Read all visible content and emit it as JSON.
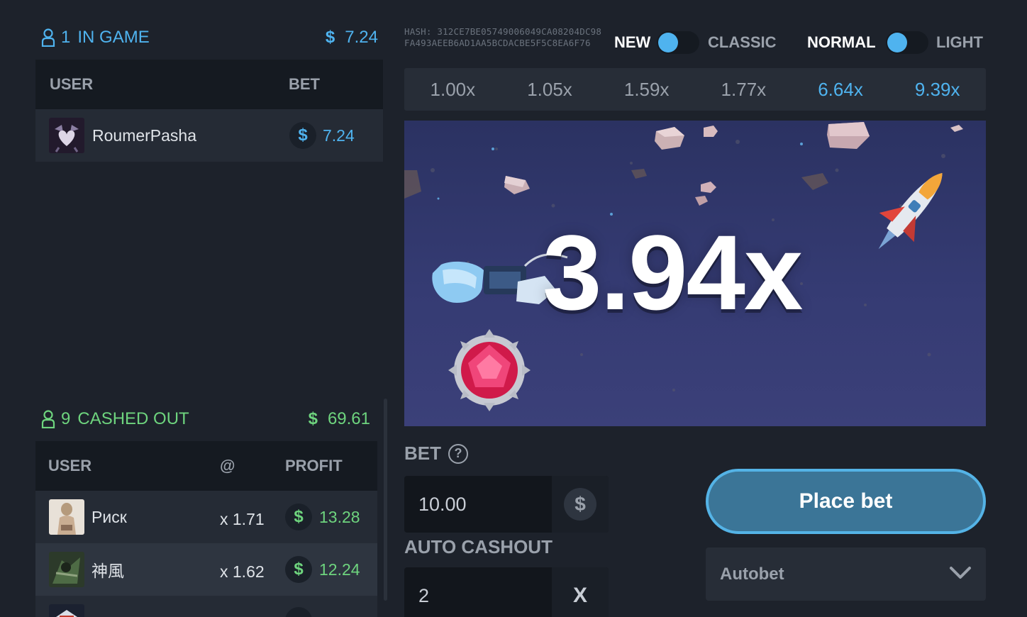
{
  "in_game": {
    "count": "1",
    "label": "IN GAME",
    "currency": "$",
    "amount": "7.24"
  },
  "bets_table": {
    "columns": [
      "USER",
      "BET"
    ],
    "rows": [
      {
        "user": "RoumerPasha",
        "currency": "$",
        "bet": "7.24"
      }
    ]
  },
  "cashed_out": {
    "count": "9",
    "label": "CASHED OUT",
    "currency": "$",
    "amount": "69.61"
  },
  "cashout_table": {
    "columns": [
      "USER",
      "@",
      "PROFIT"
    ],
    "rows": [
      {
        "user": "Риск",
        "at": "x 1.71",
        "currency": "$",
        "profit": "13.28"
      },
      {
        "user": "神風",
        "at": "x 1.62",
        "currency": "$",
        "profit": "12.24"
      }
    ]
  },
  "hash": {
    "text": "HASH: 312CE7BE05749006049CA08204DC98FA493AEEB6AD1AA5BCDACBE5F5C8EA6F76"
  },
  "toggles": {
    "new": "NEW",
    "classic": "CLASSIC",
    "normal": "NORMAL",
    "light": "LIGHT"
  },
  "history": [
    "1.00x",
    "1.05x",
    "1.59x",
    "1.77x",
    "6.64x",
    "9.39x"
  ],
  "game": {
    "multiplier": "3.94x"
  },
  "bet": {
    "label": "BET",
    "help": "?",
    "value": "10.00",
    "currency": "$"
  },
  "auto_cashout": {
    "label": "AUTO CASHOUT",
    "value": "2",
    "suffix": "X"
  },
  "place_bet": {
    "label": "Place bet"
  },
  "autobet": {
    "label": "Autobet"
  },
  "colors": {
    "accent": "#4fb3ef",
    "profit": "#6ed47e",
    "background": "#1d222b",
    "button": "#3b7597"
  },
  "icons": [
    "user-icon",
    "dollar-coin-icon",
    "help-icon",
    "chevron-down-icon"
  ]
}
